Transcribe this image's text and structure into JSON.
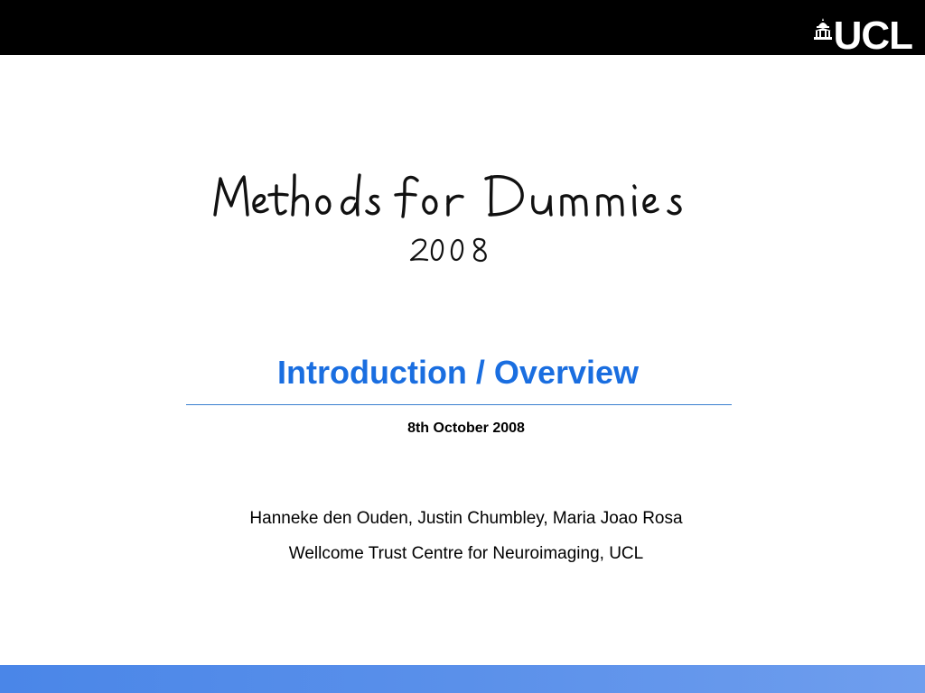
{
  "header": {
    "logo_text": "UCL"
  },
  "script_title": {
    "line1": "Methods for Dummies",
    "line2": "2008"
  },
  "title": "Introduction / Overview",
  "date": "8th October 2008",
  "authors": "Hanneke den Ouden, Justin Chumbley, Maria Joao Rosa",
  "institution": "Wellcome Trust Centre for Neuroimaging, UCL",
  "colors": {
    "top_bar": "#000000",
    "title": "#1a6ee0",
    "rule": "#3a7fd0",
    "bottom_bar": "#4a86e8"
  },
  "icons": [
    "ucl-portico-icon"
  ]
}
